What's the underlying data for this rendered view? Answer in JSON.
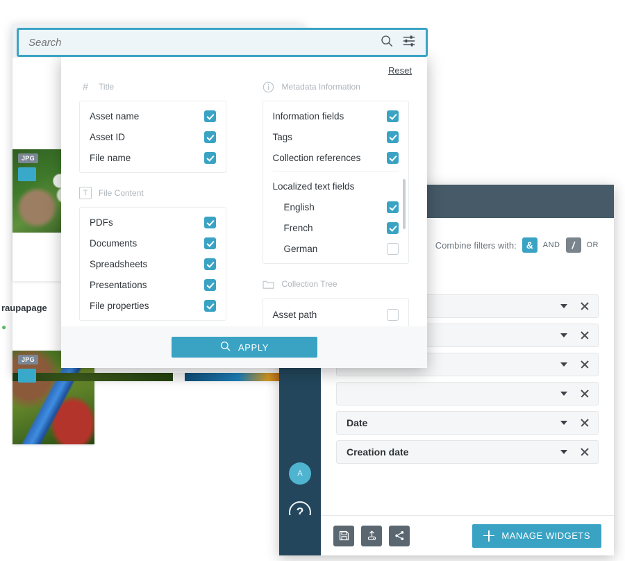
{
  "search": {
    "placeholder": "Search",
    "search_icon": "search-icon",
    "filter_icon": "sliders-icon"
  },
  "filter_popup": {
    "reset_label": "Reset",
    "apply_label": "APPLY",
    "apply_icon": "search-icon",
    "sections": [
      {
        "id": "title",
        "title": "Title",
        "icon": "hash-icon",
        "options": [
          {
            "label": "Asset name",
            "checked": true
          },
          {
            "label": "Asset ID",
            "checked": true
          },
          {
            "label": "File name",
            "checked": true
          }
        ]
      },
      {
        "id": "file-content",
        "title": "File Content",
        "icon": "text-icon",
        "options": [
          {
            "label": "PDFs",
            "checked": true
          },
          {
            "label": "Documents",
            "checked": true
          },
          {
            "label": "Spreadsheets",
            "checked": true
          },
          {
            "label": "Presentations",
            "checked": true
          },
          {
            "label": "File properties",
            "checked": true
          }
        ]
      },
      {
        "id": "metadata-information",
        "title": "Metadata Information",
        "icon": "info-icon",
        "options": [
          {
            "label": "Information fields",
            "checked": true
          },
          {
            "label": "Tags",
            "checked": true
          },
          {
            "label": "Collection references",
            "checked": true
          }
        ],
        "group_label": "Localized text fields",
        "sub_options": [
          {
            "label": "English",
            "checked": true
          },
          {
            "label": "French",
            "checked": true
          },
          {
            "label": "German",
            "checked": false
          }
        ]
      },
      {
        "id": "collection-tree",
        "title": "Collection Tree",
        "icon": "folder-icon",
        "options": [
          {
            "label": "Asset path",
            "checked": false
          }
        ]
      }
    ]
  },
  "widgets_window": {
    "combine_label": "Combine filters with:",
    "operators": [
      {
        "symbol": "&",
        "label": "AND",
        "active": true
      },
      {
        "symbol": "/",
        "label": "OR",
        "active": false
      }
    ],
    "filter_rows": [
      {
        "label": "",
        "caret_icon": "chevron-down-icon",
        "remove_icon": "close-icon"
      },
      {
        "label": "",
        "caret_icon": "chevron-down-icon",
        "remove_icon": "close-icon"
      },
      {
        "label": "",
        "caret_icon": "chevron-down-icon",
        "remove_icon": "close-icon"
      },
      {
        "label": "",
        "caret_icon": "chevron-down-icon",
        "remove_icon": "close-icon"
      },
      {
        "label": "Date",
        "caret_icon": "chevron-down-icon",
        "remove_icon": "close-icon"
      },
      {
        "label": "Creation date",
        "caret_icon": "chevron-down-icon",
        "remove_icon": "close-icon"
      }
    ],
    "sidebar": {
      "avatar_initial": "A",
      "help_label": "?",
      "logo_icon": "brand-logo-icon"
    },
    "footer": {
      "icons": [
        {
          "name": "save-icon"
        },
        {
          "name": "export-icon"
        },
        {
          "name": "share-icon"
        }
      ],
      "manage_widgets_label": "MANAGE WIDGETS",
      "manage_widgets_icon": "plus-icon"
    }
  },
  "dam_browser": {
    "assets": [
      {
        "type_badge": "JPG",
        "caption": "",
        "thumb": "flower"
      },
      {
        "type_badge": "",
        "caption": "raupapage",
        "subtitle": "",
        "thumb": ""
      },
      {
        "type_badge": "JPG",
        "caption": "",
        "thumb": "parrot"
      }
    ]
  },
  "colors": {
    "accent": "#3aa3c4",
    "header_dark": "#465a68",
    "sidebar_dark": "#23465c",
    "text_dark": "#2f353b",
    "muted": "#aeb5bb"
  }
}
